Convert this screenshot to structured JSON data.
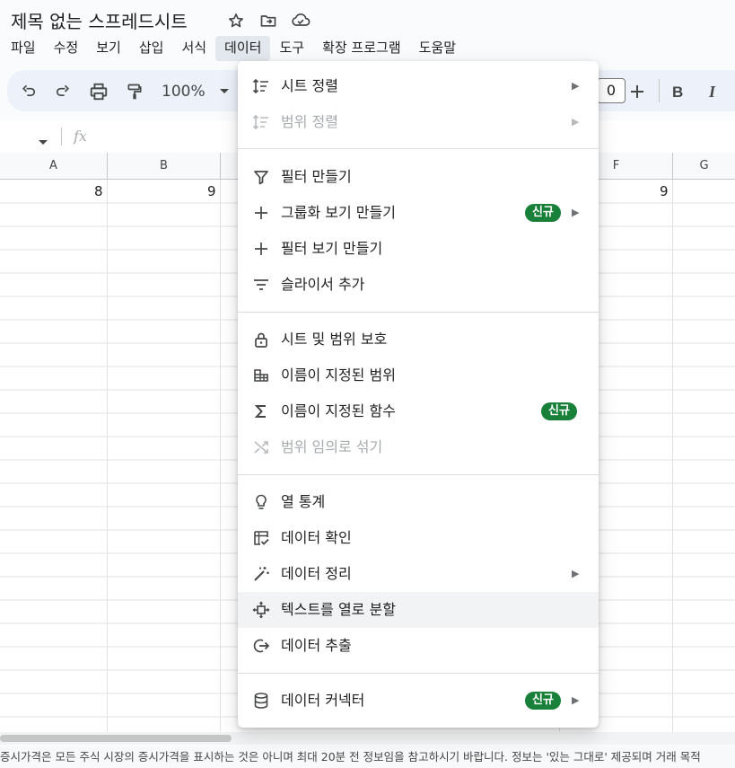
{
  "app": {
    "title": "제목 없는 스프레드시트"
  },
  "menubar": {
    "items": [
      "파일",
      "수정",
      "보기",
      "삽입",
      "서식",
      "데이터",
      "도구",
      "확장 프로그램",
      "도움말"
    ],
    "active": "데이터"
  },
  "toolbar": {
    "zoom": "100%",
    "font_size_partial": "0",
    "icons": [
      "undo-icon",
      "redo-icon",
      "print-icon",
      "paint-format-icon",
      "plus-icon",
      "bold-icon",
      "italic-icon"
    ]
  },
  "formula_bar": {
    "fx_label": "fx"
  },
  "grid": {
    "columns": [
      "A",
      "B",
      "F",
      "G"
    ],
    "row1_values": {
      "A": "8",
      "B": "9",
      "F": "9"
    }
  },
  "data_menu": {
    "sections": [
      [
        {
          "label": "시트 정렬",
          "icon": "sort-icon",
          "submenu": true,
          "disabled": false
        },
        {
          "label": "범위 정렬",
          "icon": "sort-range-icon",
          "submenu": true,
          "disabled": true
        }
      ],
      [
        {
          "label": "필터 만들기",
          "icon": "filter-icon",
          "submenu": false,
          "disabled": false
        },
        {
          "label": "그룹화 보기 만들기",
          "icon": "plus-icon",
          "submenu": true,
          "disabled": false,
          "badge": "신규"
        },
        {
          "label": "필터 보기 만들기",
          "icon": "plus-icon",
          "submenu": false,
          "disabled": false
        },
        {
          "label": "슬라이서 추가",
          "icon": "slicer-icon",
          "submenu": false,
          "disabled": false
        }
      ],
      [
        {
          "label": "시트 및 범위 보호",
          "icon": "lock-icon",
          "submenu": false,
          "disabled": false
        },
        {
          "label": "이름이 지정된 범위",
          "icon": "named-range-icon",
          "submenu": false,
          "disabled": false
        },
        {
          "label": "이름이 지정된 함수",
          "icon": "sigma-icon",
          "submenu": false,
          "disabled": false,
          "badge": "신규"
        },
        {
          "label": "범위 임의로 섞기",
          "icon": "shuffle-icon",
          "submenu": false,
          "disabled": true
        }
      ],
      [
        {
          "label": "열 통계",
          "icon": "lightbulb-icon",
          "submenu": false,
          "disabled": false
        },
        {
          "label": "데이터 확인",
          "icon": "data-validation-icon",
          "submenu": false,
          "disabled": false
        },
        {
          "label": "데이터 정리",
          "icon": "magic-wand-icon",
          "submenu": true,
          "disabled": false
        },
        {
          "label": "텍스트를 열로 분할",
          "icon": "split-icon",
          "submenu": false,
          "disabled": false,
          "hover": true
        },
        {
          "label": "데이터 추출",
          "icon": "extract-icon",
          "submenu": false,
          "disabled": false
        }
      ],
      [
        {
          "label": "데이터 커넥터",
          "icon": "database-icon",
          "submenu": true,
          "disabled": false,
          "badge": "신규"
        }
      ]
    ]
  },
  "footer": {
    "disclaimer": "증시가격은 모든 주식 시장의 증시가격을 표시하는 것은 아니며 최대 20분 전 정보임을 참고하시기 바랍니다. 정보는 '있는 그대로' 제공되며 거래 목적"
  }
}
